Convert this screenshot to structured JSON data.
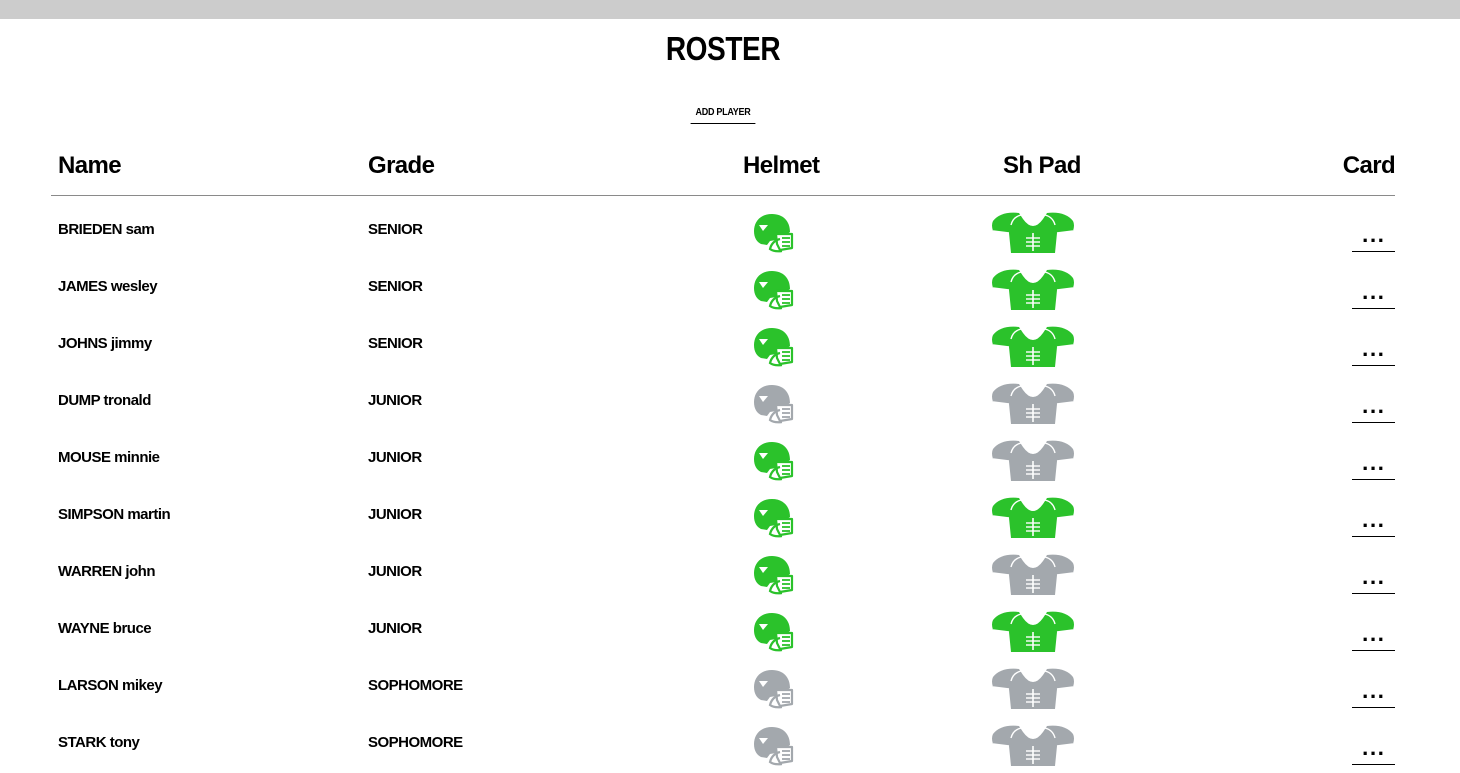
{
  "page": {
    "title": "ROSTER",
    "add_button_label": "ADD PLAYER"
  },
  "colors": {
    "issued": "#2bc22b",
    "not_issued": "#a3a8ad",
    "top_bar": "#cccccc"
  },
  "table": {
    "headers": {
      "name": "Name",
      "grade": "Grade",
      "helmet": "Helmet",
      "shpad": "Sh Pad",
      "card": "Card"
    },
    "card_button_label": "...",
    "rows": [
      {
        "name": "BRIEDEN sam",
        "grade": "SENIOR",
        "helmet_issued": true,
        "shpad_issued": true
      },
      {
        "name": "JAMES wesley",
        "grade": "SENIOR",
        "helmet_issued": true,
        "shpad_issued": true
      },
      {
        "name": "JOHNS jimmy",
        "grade": "SENIOR",
        "helmet_issued": true,
        "shpad_issued": true
      },
      {
        "name": "DUMP tronald",
        "grade": "JUNIOR",
        "helmet_issued": false,
        "shpad_issued": false
      },
      {
        "name": "MOUSE minnie",
        "grade": "JUNIOR",
        "helmet_issued": true,
        "shpad_issued": false
      },
      {
        "name": "SIMPSON martin",
        "grade": "JUNIOR",
        "helmet_issued": true,
        "shpad_issued": true
      },
      {
        "name": "WARREN john",
        "grade": "JUNIOR",
        "helmet_issued": true,
        "shpad_issued": false
      },
      {
        "name": "WAYNE bruce",
        "grade": "JUNIOR",
        "helmet_issued": true,
        "shpad_issued": true
      },
      {
        "name": "LARSON mikey",
        "grade": "SOPHOMORE",
        "helmet_issued": false,
        "shpad_issued": false
      },
      {
        "name": "STARK tony",
        "grade": "SOPHOMORE",
        "helmet_issued": false,
        "shpad_issued": false
      }
    ]
  }
}
